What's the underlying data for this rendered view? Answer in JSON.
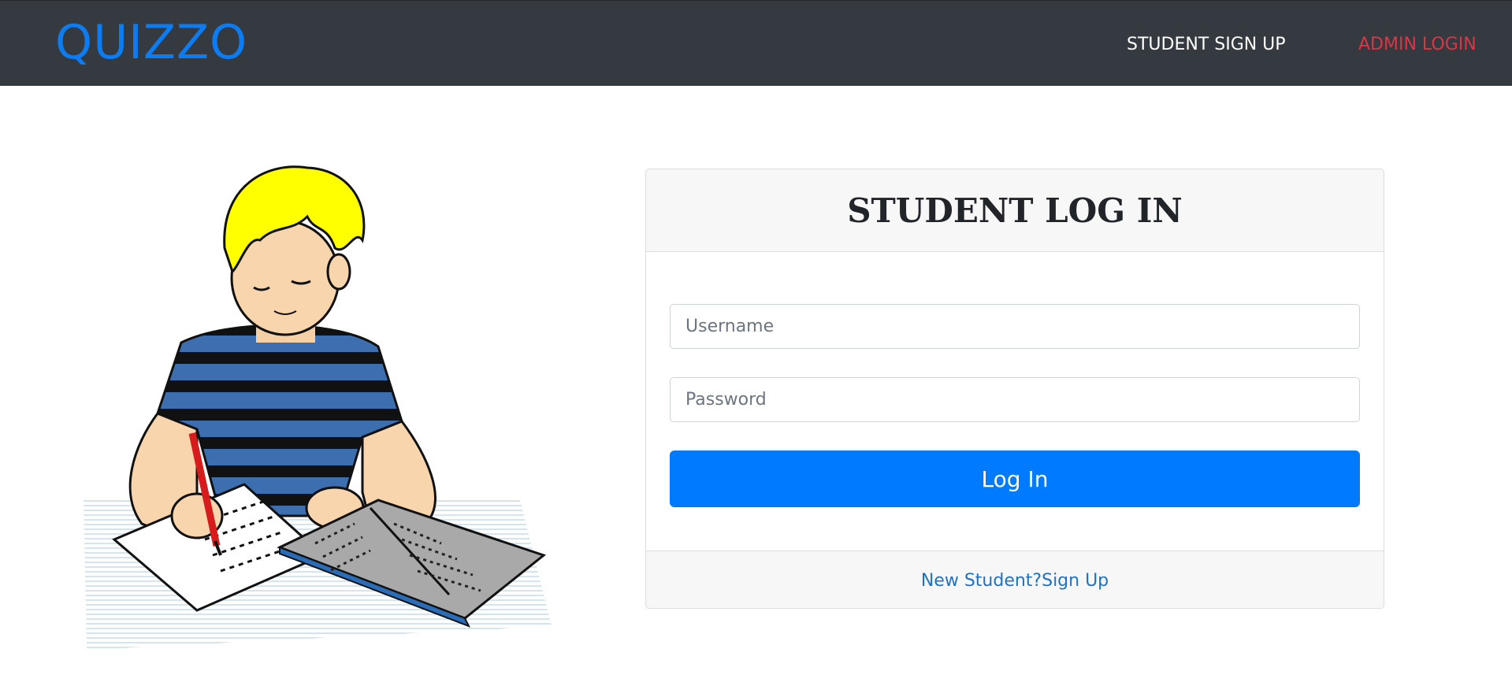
{
  "brand": {
    "name": "QUIZZO",
    "color": "#0d7bf2"
  },
  "nav": {
    "student_signup": "STUDENT SIGN UP",
    "admin_login": "ADMIN LOGIN"
  },
  "illustration": {
    "subject": "boy-studying-illustration"
  },
  "login_card": {
    "title": "STUDENT LOG IN",
    "username_placeholder": "Username",
    "username_value": "",
    "password_placeholder": "Password",
    "password_value": "",
    "submit_label": "Log In",
    "footer_link": "New Student?Sign Up"
  },
  "colors": {
    "navbar_bg": "#343a40",
    "primary": "#007bff",
    "danger": "#dc3545",
    "link": "#1d72c4"
  }
}
